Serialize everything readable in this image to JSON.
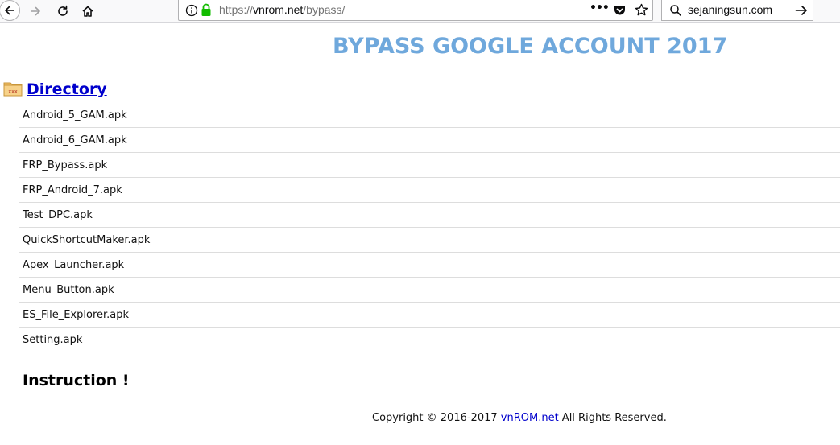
{
  "browser": {
    "url_prefix": "https://",
    "url_host": "vnrom.net",
    "url_path": "/bypass/",
    "search_text": "sejaningsun.com",
    "page_actions_label": "•••"
  },
  "page": {
    "title": "BYPASS GOOGLE ACCOUNT 2017",
    "folder_icon_text": "xxx",
    "directory_label": " Directory",
    "files": [
      "Android_5_GAM.apk",
      "Android_6_GAM.apk",
      "FRP_Bypass.apk",
      "FRP_Android_7.apk",
      "Test_DPC.apk",
      "QuickShortcutMaker.apk",
      "Apex_Launcher.apk",
      "Menu_Button.apk",
      "ES_File_Explorer.apk",
      "Setting.apk"
    ],
    "instruction_heading": "Instruction !",
    "footer": {
      "prefix": "Copyright © 2016-2017 ",
      "link_text": "vnROM.net",
      "suffix": " All Rights Reserved."
    }
  },
  "colors": {
    "title": "#6fa8dc",
    "link": "#0000cc",
    "lock_icon": "#12bc00"
  }
}
